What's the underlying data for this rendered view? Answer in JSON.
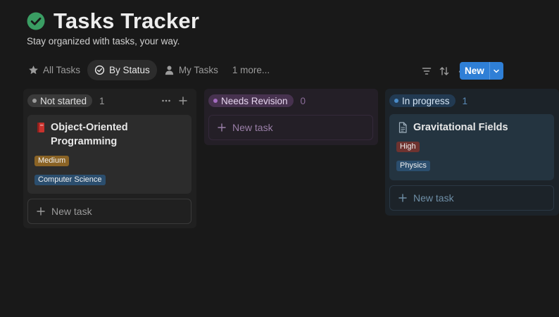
{
  "header": {
    "title": "Tasks Tracker",
    "subtitle": "Stay organized with tasks, your way.",
    "icon": "check-circle-icon",
    "icon_color": "#3a9d63"
  },
  "tabs": [
    {
      "label": "All Tasks",
      "icon": "star-icon",
      "active": false
    },
    {
      "label": "By Status",
      "icon": "status-circle-icon",
      "active": true
    },
    {
      "label": "My Tasks",
      "icon": "person-icon",
      "active": false
    },
    {
      "label": "1 more...",
      "active": false
    }
  ],
  "toolbar": {
    "icons": [
      "filter-icon",
      "sort-icon",
      "lightning-icon",
      "search-icon",
      "settings-sliders-icon"
    ],
    "new_label": "New",
    "accent": "#2f7fd6"
  },
  "columns": [
    {
      "status": "Not started",
      "count": "1",
      "colors": {
        "pill": "#3a3a3a",
        "dot": "#9b9b9b",
        "text": "#e0e0e0"
      },
      "cards": [
        {
          "icon": "book-icon",
          "title_lines": [
            "Object-Oriented",
            "Programming"
          ],
          "tags": [
            {
              "label": "Medium",
              "color": "#8a6325"
            },
            {
              "label": "Computer Science",
              "color": "#2b4e6e"
            }
          ]
        }
      ],
      "new_task_label": "New task"
    },
    {
      "status": "Needs Revision",
      "count": "0",
      "colors": {
        "pill": "#47324f",
        "dot": "#a46cc1",
        "text": "#e6d6ee"
      },
      "cards": [],
      "new_task_label": "New task"
    },
    {
      "status": "In progress",
      "count": "1",
      "colors": {
        "pill": "#223a52",
        "dot": "#4a8bc8",
        "text": "#d6e6f5"
      },
      "cards": [
        {
          "icon": "page-icon",
          "title_lines": [
            "Gravitational Fields"
          ],
          "tags": [
            {
              "label": "High",
              "color": "#6e3330"
            },
            {
              "label": "Physics",
              "color": "#2b4e6e"
            }
          ]
        }
      ],
      "new_task_label": "New task"
    }
  ]
}
